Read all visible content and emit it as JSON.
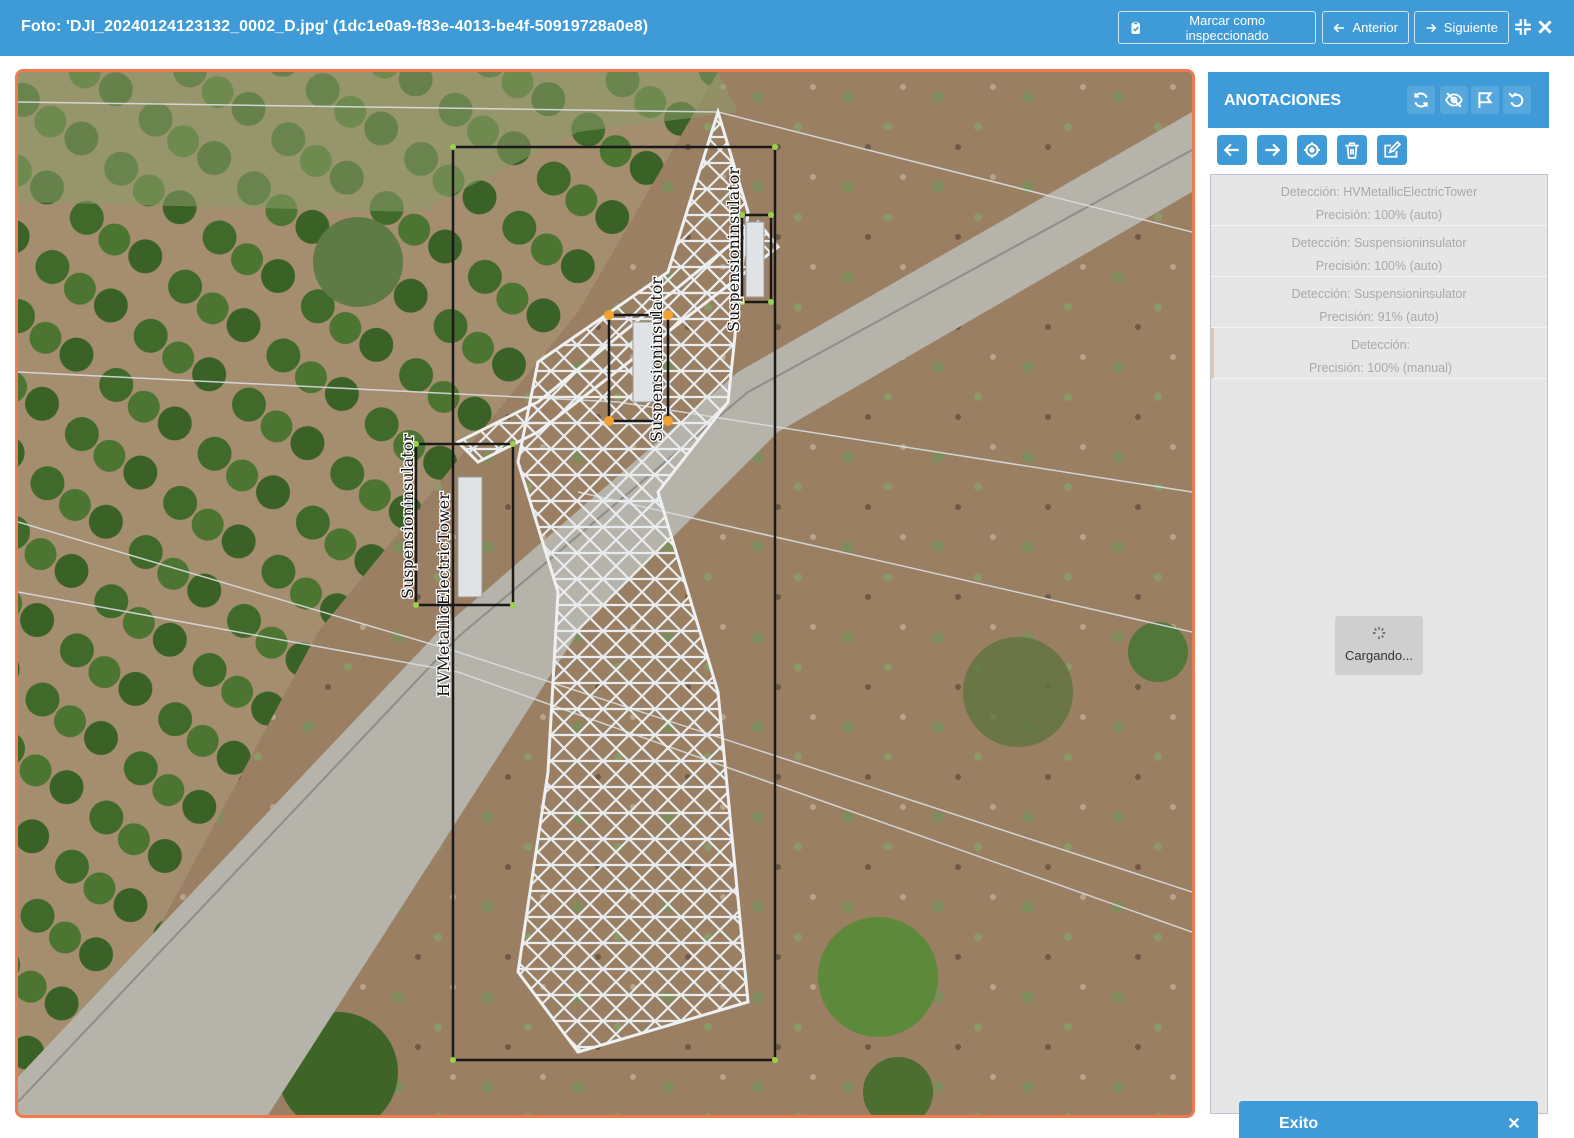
{
  "header": {
    "title": "Foto: 'DJI_20240124123132_0002_D.jpg' (1dc1e0a9-f83e-4013-be4f-50919728a0e8)",
    "mark_inspected_label": "Marcar como inspeccionado",
    "prev_label": "Anterior",
    "next_label": "Siguiente",
    "color": "#3e9bd8"
  },
  "viewer": {
    "border_color": "#f07a4e",
    "boxes": [
      {
        "label": "HVMetallicElectricTower",
        "color": "#1a1a1a"
      },
      {
        "label": "Suspensioninsulator",
        "color": "#1a1a1a"
      },
      {
        "label": "Suspensioninsulator",
        "color": "#1a1a1a"
      },
      {
        "label": "Suspensioninsulator",
        "color": "#1a1a1a"
      }
    ]
  },
  "panel": {
    "title": "ANOTACIONES",
    "detections": [
      {
        "line1": "Detección: HVMetallicElectricTower",
        "line2": "Precisión: 100% (auto)"
      },
      {
        "line1": "Detección: Suspensioninsulator",
        "line2": "Precisión: 100% (auto)"
      },
      {
        "line1": "Detección: Suspensioninsulator",
        "line2": "Precisión: 91% (auto)"
      },
      {
        "line1": "Detección:",
        "line2": "Precisión: 100% (manual)"
      }
    ],
    "loading_text": "Cargando..."
  },
  "toast": {
    "message": "Exito"
  }
}
